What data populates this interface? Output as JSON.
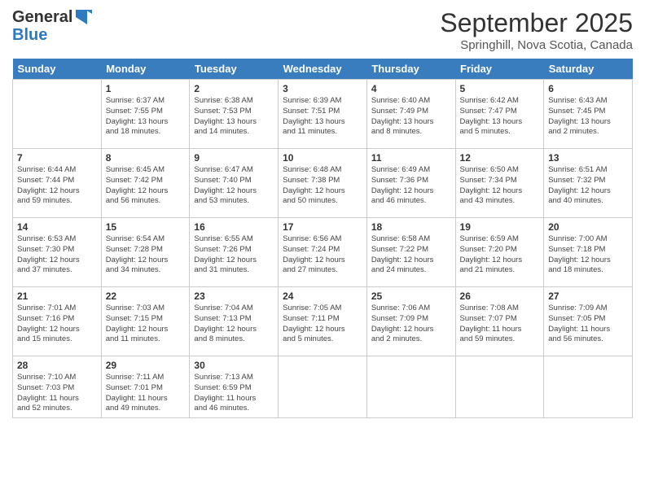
{
  "header": {
    "logo_line1": "General",
    "logo_line2": "Blue",
    "month": "September 2025",
    "location": "Springhill, Nova Scotia, Canada"
  },
  "days_of_week": [
    "Sunday",
    "Monday",
    "Tuesday",
    "Wednesday",
    "Thursday",
    "Friday",
    "Saturday"
  ],
  "weeks": [
    [
      {
        "day": "",
        "info": ""
      },
      {
        "day": "1",
        "info": "Sunrise: 6:37 AM\nSunset: 7:55 PM\nDaylight: 13 hours\nand 18 minutes."
      },
      {
        "day": "2",
        "info": "Sunrise: 6:38 AM\nSunset: 7:53 PM\nDaylight: 13 hours\nand 14 minutes."
      },
      {
        "day": "3",
        "info": "Sunrise: 6:39 AM\nSunset: 7:51 PM\nDaylight: 13 hours\nand 11 minutes."
      },
      {
        "day": "4",
        "info": "Sunrise: 6:40 AM\nSunset: 7:49 PM\nDaylight: 13 hours\nand 8 minutes."
      },
      {
        "day": "5",
        "info": "Sunrise: 6:42 AM\nSunset: 7:47 PM\nDaylight: 13 hours\nand 5 minutes."
      },
      {
        "day": "6",
        "info": "Sunrise: 6:43 AM\nSunset: 7:45 PM\nDaylight: 13 hours\nand 2 minutes."
      }
    ],
    [
      {
        "day": "7",
        "info": "Sunrise: 6:44 AM\nSunset: 7:44 PM\nDaylight: 12 hours\nand 59 minutes."
      },
      {
        "day": "8",
        "info": "Sunrise: 6:45 AM\nSunset: 7:42 PM\nDaylight: 12 hours\nand 56 minutes."
      },
      {
        "day": "9",
        "info": "Sunrise: 6:47 AM\nSunset: 7:40 PM\nDaylight: 12 hours\nand 53 minutes."
      },
      {
        "day": "10",
        "info": "Sunrise: 6:48 AM\nSunset: 7:38 PM\nDaylight: 12 hours\nand 50 minutes."
      },
      {
        "day": "11",
        "info": "Sunrise: 6:49 AM\nSunset: 7:36 PM\nDaylight: 12 hours\nand 46 minutes."
      },
      {
        "day": "12",
        "info": "Sunrise: 6:50 AM\nSunset: 7:34 PM\nDaylight: 12 hours\nand 43 minutes."
      },
      {
        "day": "13",
        "info": "Sunrise: 6:51 AM\nSunset: 7:32 PM\nDaylight: 12 hours\nand 40 minutes."
      }
    ],
    [
      {
        "day": "14",
        "info": "Sunrise: 6:53 AM\nSunset: 7:30 PM\nDaylight: 12 hours\nand 37 minutes."
      },
      {
        "day": "15",
        "info": "Sunrise: 6:54 AM\nSunset: 7:28 PM\nDaylight: 12 hours\nand 34 minutes."
      },
      {
        "day": "16",
        "info": "Sunrise: 6:55 AM\nSunset: 7:26 PM\nDaylight: 12 hours\nand 31 minutes."
      },
      {
        "day": "17",
        "info": "Sunrise: 6:56 AM\nSunset: 7:24 PM\nDaylight: 12 hours\nand 27 minutes."
      },
      {
        "day": "18",
        "info": "Sunrise: 6:58 AM\nSunset: 7:22 PM\nDaylight: 12 hours\nand 24 minutes."
      },
      {
        "day": "19",
        "info": "Sunrise: 6:59 AM\nSunset: 7:20 PM\nDaylight: 12 hours\nand 21 minutes."
      },
      {
        "day": "20",
        "info": "Sunrise: 7:00 AM\nSunset: 7:18 PM\nDaylight: 12 hours\nand 18 minutes."
      }
    ],
    [
      {
        "day": "21",
        "info": "Sunrise: 7:01 AM\nSunset: 7:16 PM\nDaylight: 12 hours\nand 15 minutes."
      },
      {
        "day": "22",
        "info": "Sunrise: 7:03 AM\nSunset: 7:15 PM\nDaylight: 12 hours\nand 11 minutes."
      },
      {
        "day": "23",
        "info": "Sunrise: 7:04 AM\nSunset: 7:13 PM\nDaylight: 12 hours\nand 8 minutes."
      },
      {
        "day": "24",
        "info": "Sunrise: 7:05 AM\nSunset: 7:11 PM\nDaylight: 12 hours\nand 5 minutes."
      },
      {
        "day": "25",
        "info": "Sunrise: 7:06 AM\nSunset: 7:09 PM\nDaylight: 12 hours\nand 2 minutes."
      },
      {
        "day": "26",
        "info": "Sunrise: 7:08 AM\nSunset: 7:07 PM\nDaylight: 11 hours\nand 59 minutes."
      },
      {
        "day": "27",
        "info": "Sunrise: 7:09 AM\nSunset: 7:05 PM\nDaylight: 11 hours\nand 56 minutes."
      }
    ],
    [
      {
        "day": "28",
        "info": "Sunrise: 7:10 AM\nSunset: 7:03 PM\nDaylight: 11 hours\nand 52 minutes."
      },
      {
        "day": "29",
        "info": "Sunrise: 7:11 AM\nSunset: 7:01 PM\nDaylight: 11 hours\nand 49 minutes."
      },
      {
        "day": "30",
        "info": "Sunrise: 7:13 AM\nSunset: 6:59 PM\nDaylight: 11 hours\nand 46 minutes."
      },
      {
        "day": "",
        "info": ""
      },
      {
        "day": "",
        "info": ""
      },
      {
        "day": "",
        "info": ""
      },
      {
        "day": "",
        "info": ""
      }
    ]
  ]
}
